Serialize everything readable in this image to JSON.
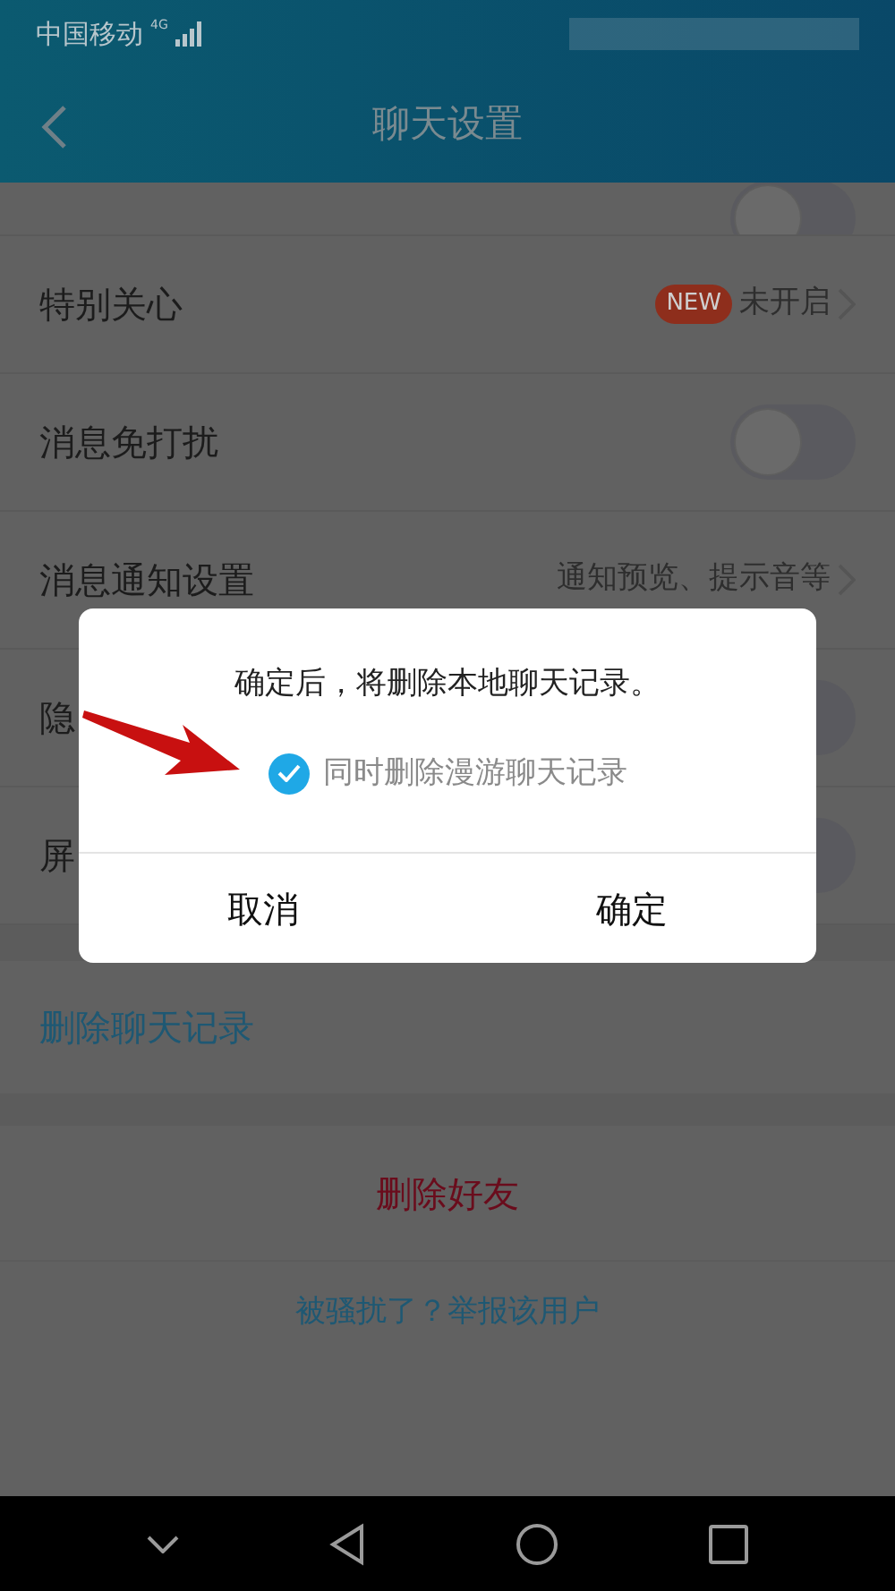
{
  "status_bar": {
    "carrier": "中国移动",
    "network": "4G"
  },
  "header": {
    "title": "聊天设置"
  },
  "settings": [
    {
      "kind": "switch",
      "on": false
    },
    {
      "kind": "link",
      "label": "特别关心",
      "badge": "NEW",
      "value": "未开启"
    },
    {
      "kind": "switch",
      "label": "消息免打扰",
      "on": false
    },
    {
      "kind": "link",
      "label": "消息通知设置",
      "value": "通知预览、提示音等"
    },
    {
      "kind": "switch",
      "label": "隐",
      "on": false
    },
    {
      "kind": "switch",
      "label": "屏",
      "on": false
    }
  ],
  "clear_history": "删除聊天记录",
  "delete_friend": "删除好友",
  "report": "被骚扰了？举报该用户",
  "dialog": {
    "message": "确定后，将删除本地聊天记录。",
    "option": {
      "label": "同时删除漫游聊天记录",
      "checked": true
    },
    "buttons": [
      "取消",
      "确定"
    ]
  }
}
